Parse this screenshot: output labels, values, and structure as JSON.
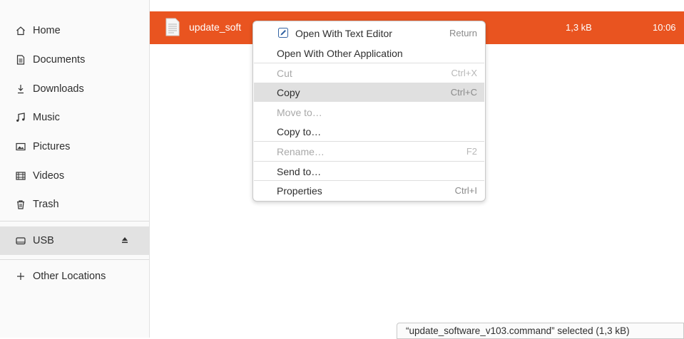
{
  "sidebar": {
    "items": [
      {
        "label": "Home",
        "icon": "home-icon"
      },
      {
        "label": "Documents",
        "icon": "documents-icon"
      },
      {
        "label": "Downloads",
        "icon": "downloads-icon"
      },
      {
        "label": "Music",
        "icon": "music-icon"
      },
      {
        "label": "Pictures",
        "icon": "pictures-icon"
      },
      {
        "label": "Videos",
        "icon": "videos-icon"
      },
      {
        "label": "Trash",
        "icon": "trash-icon"
      }
    ],
    "usb": {
      "label": "USB",
      "icon": "drive-icon",
      "eject_icon": "eject-icon"
    },
    "other_locations": {
      "label": "Other Locations",
      "icon": "plus-icon"
    }
  },
  "file_row": {
    "name": "update_soft",
    "size": "1,3 kB",
    "time": "10:06",
    "selected_color": "#e95420"
  },
  "context_menu": {
    "open_with_text_editor": {
      "label": "Open With Text Editor",
      "accel": "Return",
      "icon": "text-editor-icon"
    },
    "open_with_other": {
      "label": "Open With Other Application"
    },
    "cut": {
      "label": "Cut",
      "accel": "Ctrl+X"
    },
    "copy": {
      "label": "Copy",
      "accel": "Ctrl+C"
    },
    "move_to": {
      "label": "Move to…"
    },
    "copy_to": {
      "label": "Copy to…"
    },
    "rename": {
      "label": "Rename…",
      "accel": "F2"
    },
    "send_to": {
      "label": "Send to…"
    },
    "properties": {
      "label": "Properties",
      "accel": "Ctrl+I"
    }
  },
  "status_bar": {
    "text": "“update_software_v103.command” selected (1,3 kB)"
  }
}
